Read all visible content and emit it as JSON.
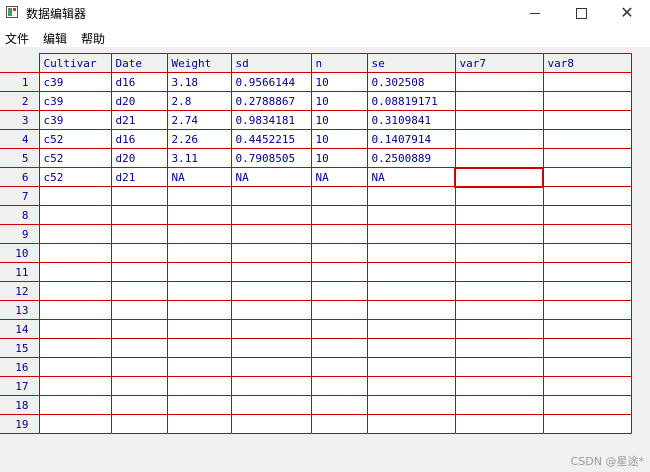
{
  "window": {
    "title": "数据编辑器",
    "minimize_label": "—",
    "maximize_label": "□",
    "close_label": "✕"
  },
  "menu": {
    "items": [
      {
        "label": "文件"
      },
      {
        "label": "编辑"
      },
      {
        "label": "帮助"
      }
    ]
  },
  "grid": {
    "columns": [
      "Cultivar",
      "Date",
      "Weight",
      "sd",
      "n",
      "se",
      "var7",
      "var8"
    ],
    "rows": [
      {
        "num": "1",
        "cells": [
          "c39",
          "d16",
          "3.18",
          "0.9566144",
          "10",
          "0.302508",
          "",
          ""
        ]
      },
      {
        "num": "2",
        "cells": [
          "c39",
          "d20",
          "2.8",
          "0.2788867",
          "10",
          "0.08819171",
          "",
          ""
        ]
      },
      {
        "num": "3",
        "cells": [
          "c39",
          "d21",
          "2.74",
          "0.9834181",
          "10",
          "0.3109841",
          "",
          ""
        ]
      },
      {
        "num": "4",
        "cells": [
          "c52",
          "d16",
          "2.26",
          "0.4452215",
          "10",
          "0.1407914",
          "",
          ""
        ]
      },
      {
        "num": "5",
        "cells": [
          "c52",
          "d20",
          "3.11",
          "0.7908505",
          "10",
          "0.2500889",
          "",
          ""
        ]
      },
      {
        "num": "6",
        "cells": [
          "c52",
          "d21",
          "NA",
          "NA",
          "NA",
          "NA",
          "",
          ""
        ]
      },
      {
        "num": "7",
        "cells": [
          "",
          "",
          "",
          "",
          "",
          "",
          "",
          ""
        ]
      },
      {
        "num": "8",
        "cells": [
          "",
          "",
          "",
          "",
          "",
          "",
          "",
          ""
        ]
      },
      {
        "num": "9",
        "cells": [
          "",
          "",
          "",
          "",
          "",
          "",
          "",
          ""
        ]
      },
      {
        "num": "10",
        "cells": [
          "",
          "",
          "",
          "",
          "",
          "",
          "",
          ""
        ]
      },
      {
        "num": "11",
        "cells": [
          "",
          "",
          "",
          "",
          "",
          "",
          "",
          ""
        ]
      },
      {
        "num": "12",
        "cells": [
          "",
          "",
          "",
          "",
          "",
          "",
          "",
          ""
        ]
      },
      {
        "num": "13",
        "cells": [
          "",
          "",
          "",
          "",
          "",
          "",
          "",
          ""
        ]
      },
      {
        "num": "14",
        "cells": [
          "",
          "",
          "",
          "",
          "",
          "",
          "",
          ""
        ]
      },
      {
        "num": "15",
        "cells": [
          "",
          "",
          "",
          "",
          "",
          "",
          "",
          ""
        ]
      },
      {
        "num": "16",
        "cells": [
          "",
          "",
          "",
          "",
          "",
          "",
          "",
          ""
        ]
      },
      {
        "num": "17",
        "cells": [
          "",
          "",
          "",
          "",
          "",
          "",
          "",
          ""
        ]
      },
      {
        "num": "18",
        "cells": [
          "",
          "",
          "",
          "",
          "",
          "",
          "",
          ""
        ]
      },
      {
        "num": "19",
        "cells": [
          "",
          "",
          "",
          "",
          "",
          "",
          "",
          ""
        ]
      }
    ]
  },
  "watermark": "CSDN @星途*",
  "colors": {
    "grid_line": "#cc0000",
    "cell_text": "#00008b",
    "header_bg": "#f0f0f0"
  }
}
